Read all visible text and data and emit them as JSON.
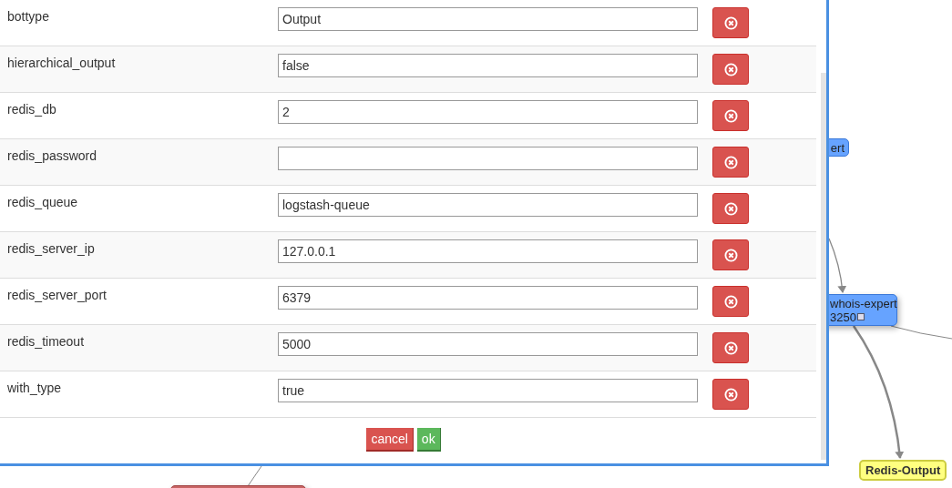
{
  "dialog": {
    "fields": [
      {
        "label": "bottype",
        "value": "Output"
      },
      {
        "label": "hierarchical_output",
        "value": "false"
      },
      {
        "label": "redis_db",
        "value": "2"
      },
      {
        "label": "redis_password"
      },
      {
        "label": "redis_queue",
        "value": "logstash-queue"
      },
      {
        "label": "redis_server_ip",
        "value": "127.0.0.1"
      },
      {
        "label": "redis_server_port",
        "value": "6379"
      },
      {
        "label": "redis_timeout",
        "value": "5000"
      },
      {
        "label": "with_type",
        "value": "true"
      }
    ],
    "buttons": [
      {
        "label": "cancel",
        "kind": "cancel"
      },
      {
        "label": "ok",
        "kind": "ok"
      }
    ]
  },
  "graph": {
    "nodes": [
      {
        "lines": [
          "ert"
        ],
        "color": "#66a3ff",
        "kind": "partial"
      },
      {
        "lines": [
          "whois-expert",
          "3250"
        ],
        "color": "#66a3ff",
        "kind": "expert"
      },
      {
        "lines": [
          "Redis-Output"
        ],
        "color": "#ffff80",
        "kind": "output"
      },
      {
        "color": "#c86464",
        "kind": "bottom"
      }
    ]
  }
}
